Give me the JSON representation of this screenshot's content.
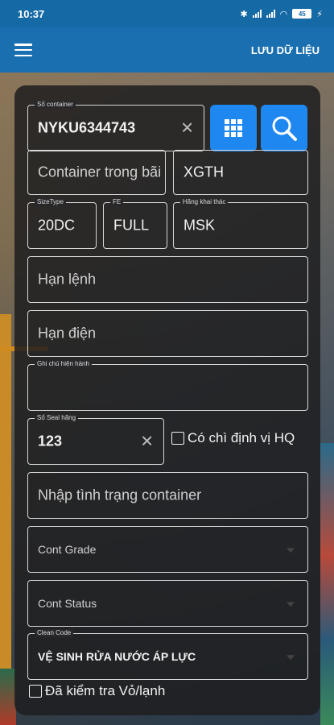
{
  "status_bar": {
    "time": "10:37",
    "battery": "45"
  },
  "app_bar": {
    "action_label": "LƯU DỮ LIỆU"
  },
  "form": {
    "container_no": {
      "label": "Số container",
      "value": "NYKU6344743"
    },
    "container_in": {
      "placeholder": "Container trong bãi"
    },
    "xgth": {
      "value": "XGTH"
    },
    "size_type": {
      "label": "SizeType",
      "value": "20DC"
    },
    "fe": {
      "label": "FE",
      "value": "FULL"
    },
    "operator": {
      "label": "Hãng khai thác",
      "value": "MSK"
    },
    "order_deadline": {
      "placeholder": "Hạn lệnh"
    },
    "power_deadline": {
      "placeholder": "Hạn điện"
    },
    "current_note": {
      "label": "Ghi chú hiện hành",
      "value": ""
    },
    "seal_no": {
      "label": "Số Seal hãng",
      "value": "123"
    },
    "customs_seal_check": {
      "label": "Có chì định vị HQ"
    },
    "container_status_input": {
      "placeholder": "Nhập tình trạng container"
    },
    "cont_grade": {
      "value": "Cont Grade"
    },
    "cont_status": {
      "value": "Cont Status"
    },
    "clean_code": {
      "label": "Clean Code",
      "value": "VỆ SINH RỬA NƯỚC ÁP LỰC"
    },
    "shell_check": {
      "label": "Đã kiểm tra Vỏ/lạnh"
    }
  }
}
